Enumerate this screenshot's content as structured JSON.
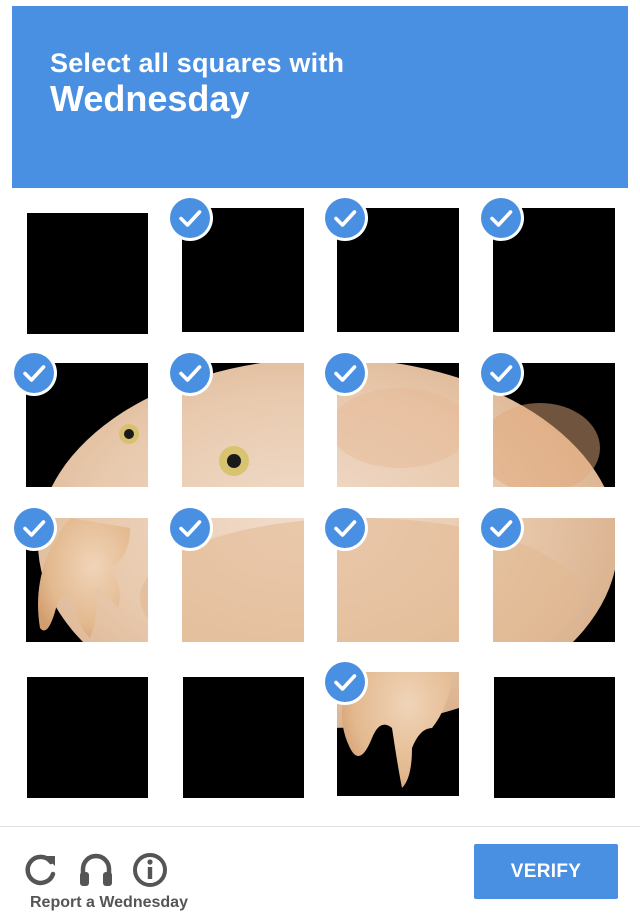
{
  "header": {
    "instruction": "Select all squares with",
    "target": "Wednesday",
    "background_color": "#4a90e2"
  },
  "grid": {
    "rows": 4,
    "columns": 4,
    "selected": [
      [
        false,
        true,
        true,
        true
      ],
      [
        true,
        true,
        true,
        true
      ],
      [
        true,
        true,
        true,
        true
      ],
      [
        false,
        false,
        true,
        false
      ]
    ],
    "tile_subject": "wednesday-frog"
  },
  "footer": {
    "icons": [
      "reload-icon",
      "audio-challenge-icon",
      "info-icon"
    ],
    "report_label": "Report a Wednesday",
    "verify_label": "VERIFY",
    "accent_color": "#4a90e2"
  }
}
